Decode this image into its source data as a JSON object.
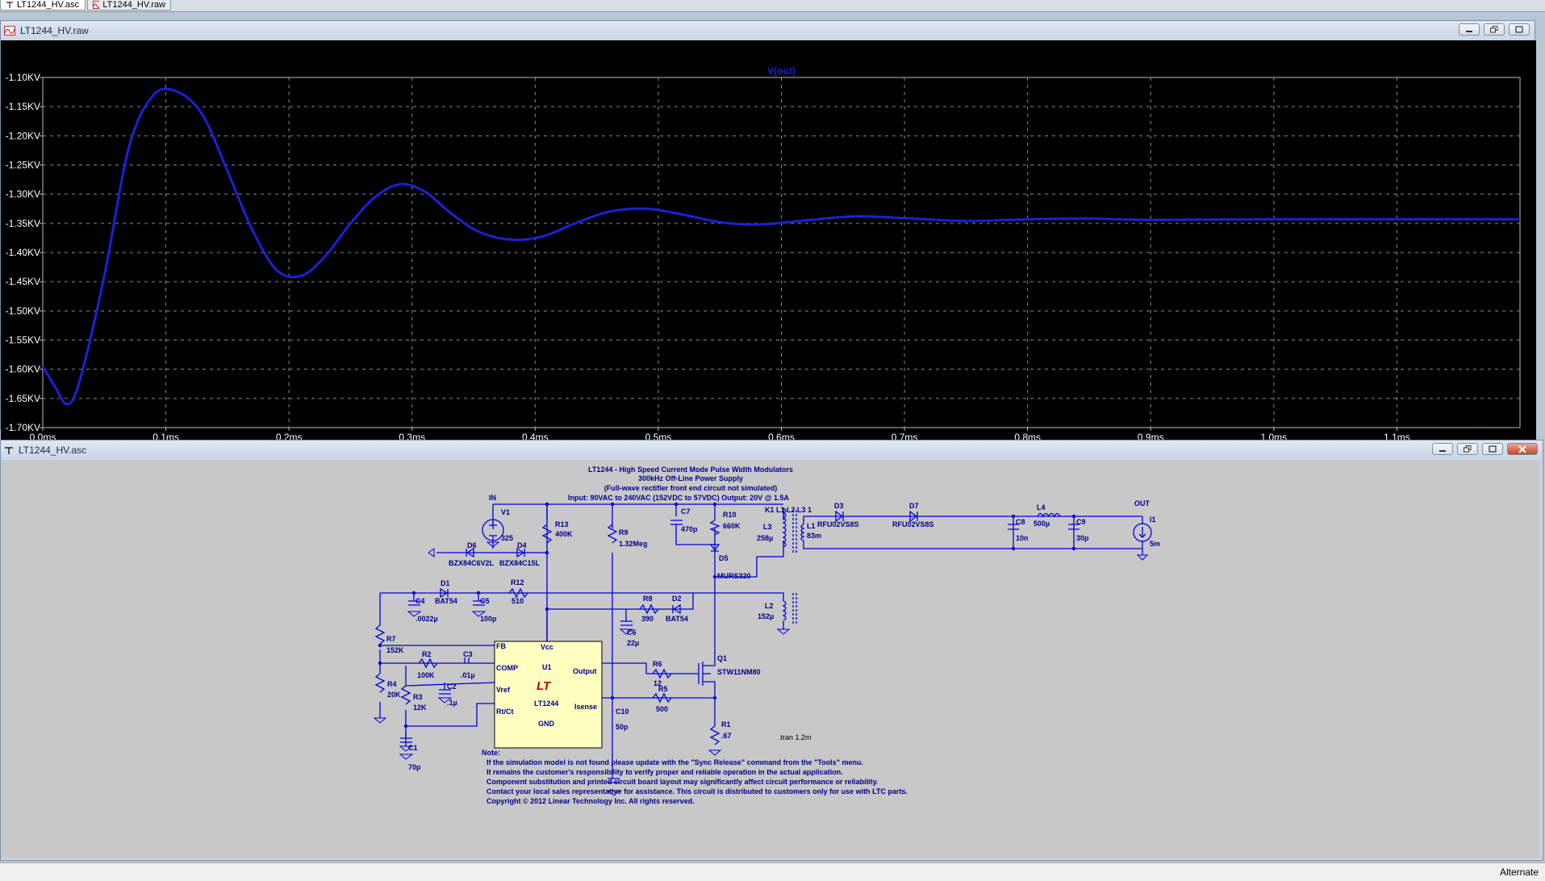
{
  "tabs": [
    {
      "label": "LT1244_HV.asc",
      "active": true
    },
    {
      "label": "LT1244_HV.raw",
      "active": false
    }
  ],
  "waveform_window": {
    "title": "LT1244_HV.raw",
    "trace_label": "V(out)",
    "trace_color": "#1a22d6"
  },
  "chart_data": {
    "type": "line",
    "title": "",
    "series": [
      {
        "name": "V(out)",
        "x": [
          0.0,
          0.01,
          0.02,
          0.03,
          0.05,
          0.07,
          0.09,
          0.11,
          0.13,
          0.15,
          0.17,
          0.19,
          0.21,
          0.23,
          0.25,
          0.27,
          0.29,
          0.31,
          0.33,
          0.35,
          0.37,
          0.39,
          0.41,
          0.43,
          0.46,
          0.49,
          0.52,
          0.55,
          0.58,
          0.62,
          0.66,
          0.7,
          0.75,
          0.8,
          0.85,
          0.9,
          1.0,
          1.1,
          1.2
        ],
        "y": [
          -1.595,
          -1.63,
          -1.66,
          -1.62,
          -1.44,
          -1.22,
          -1.13,
          -1.125,
          -1.165,
          -1.26,
          -1.36,
          -1.43,
          -1.44,
          -1.405,
          -1.35,
          -1.305,
          -1.283,
          -1.295,
          -1.33,
          -1.36,
          -1.375,
          -1.378,
          -1.37,
          -1.352,
          -1.33,
          -1.325,
          -1.335,
          -1.348,
          -1.352,
          -1.345,
          -1.338,
          -1.341,
          -1.346,
          -1.343,
          -1.342,
          -1.344,
          -1.343,
          -1.343,
          -1.343
        ]
      }
    ],
    "x_ticks": [
      "0.0ms",
      "0.1ms",
      "0.2ms",
      "0.3ms",
      "0.4ms",
      "0.5ms",
      "0.6ms",
      "0.7ms",
      "0.8ms",
      "0.9ms",
      "1.0ms",
      "1.1ms"
    ],
    "y_ticks": [
      "-1.10KV",
      "-1.15KV",
      "-1.20KV",
      "-1.25KV",
      "-1.30KV",
      "-1.35KV",
      "-1.40KV",
      "-1.45KV",
      "-1.50KV",
      "-1.55KV",
      "-1.60KV",
      "-1.65KV",
      "-1.70KV"
    ],
    "xlim": [
      0,
      1.2
    ],
    "ylim": [
      -1.7,
      -1.1
    ],
    "grid": true
  },
  "schematic_window": {
    "title": "LT1244_HV.asc",
    "heading": [
      "LT1244 - High Speed Current Mode Pulse Width Modulators",
      "300kHz Off-Line Power Supply",
      "(Full-wave rectifier front end circuit not simulated)",
      "Input: 90VAC to 240VAC (152VDC to 57VDC)    Output: 20V @ 1.5A"
    ],
    "labels": {
      "in": "IN",
      "out": "OUT",
      "v1": "V1",
      "v1v": "325",
      "r13": "R13",
      "r13v": "400K",
      "r9": "R9",
      "r9v": "1.32Meg",
      "c7": "C7",
      "c7v": "470p",
      "r10": "R10",
      "r10v": "660K",
      "d5": "D5",
      "d5v": "MURS320",
      "k1": "K1 L1 L2 L3 1",
      "l3": "L3",
      "l3v": "258µ",
      "l1": "L1",
      "l1v": "83m",
      "d3": "D3",
      "d3v": "RFU02VS8S",
      "d7": "D7",
      "d7v": "RFU02VS8S",
      "l4": "L4",
      "l4v": "500µ",
      "c8": "C8",
      "c8v": "10n",
      "c9": "C9",
      "c9v": "30p",
      "i1": "I1",
      "i1v": "5m",
      "d6": "D6",
      "d6v": "BZX84C6V2L",
      "d4": "D4",
      "d4v": "BZX84C15L",
      "d1": "D1",
      "d1v": "BAT54",
      "r12": "R12",
      "r12v": "510",
      "c4": "C4",
      "c4v": ".0022µ",
      "c5": "C5",
      "c5v": "100p",
      "r8": "R8",
      "r8v": "390",
      "d2": "D2",
      "d2v": "BAT54",
      "l2": "L2",
      "l2v": "152µ",
      "c6": "C6",
      "c6v": "22µ",
      "r7": "R7",
      "r7v": "152K",
      "r2": "R2",
      "r2v": "100K",
      "c3": "C3",
      "c3v": ".01µ",
      "r4": "R4",
      "r4v": "20K",
      "r3": "R3",
      "r3v": "12K",
      "c2": "C2",
      "c2v": ".1µ",
      "c1": "C1",
      "c1v": "70p",
      "c10": "C10",
      "c10v": "50p",
      "r6": "R6",
      "r6v": "12",
      "q1": "Q1",
      "q1v": "STW11NM80",
      "r5": "R5",
      "r5v": "500",
      "r1": "R1",
      "r1v": ".67",
      "tran": ".tran 1.2m"
    },
    "ic": {
      "pins_left": [
        "FB",
        "COMP",
        "Vref",
        "Rt/Ct"
      ],
      "vcc": "Vcc",
      "ref": "U1",
      "part": "LT1244",
      "gnd": "GND",
      "output": "Output",
      "isense": "Isense",
      "logo": "LT"
    },
    "note_title": "Note:",
    "notes": [
      "If the simulation model is not found please update with the \"Sync Release\" command from the \"Tools\" menu.",
      "It remains the customer's responsibility to verify proper and reliable operation in the actual application.",
      "Component substitution and printed circuit board layout may significantly affect circuit performance or reliability.",
      "Contact your local sales representative for assistance. This circuit is distributed to customers only for use with LTC parts.",
      "Copyright © 2012 Linear Technology Inc. All rights reserved."
    ]
  },
  "status_bar": {
    "text": "Alternate"
  }
}
